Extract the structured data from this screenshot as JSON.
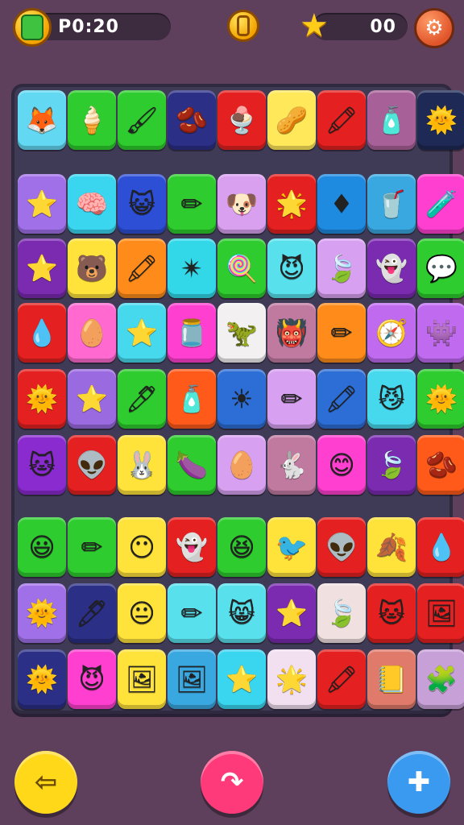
{
  "hud": {
    "moves_label": "P0:20",
    "moves_icon": "leaf-coin-icon",
    "center_icon": "gold-coin-icon",
    "score_value": "00",
    "score_icon": "star-icon",
    "settings_icon": "gear-icon"
  },
  "board": {
    "rows": [
      [
        {
          "color": "#63d8f2",
          "icon": "fox-face-icon",
          "g": "🦊"
        },
        {
          "color": "#2ecc2e",
          "icon": "ice-cream-icon",
          "g": "🍦"
        },
        {
          "color": "#2ecc2e",
          "icon": "brush-icon",
          "g": "🖌"
        },
        {
          "color": "#2b2f86",
          "icon": "jellybean-icon",
          "g": "🫘"
        },
        {
          "color": "#e52020",
          "icon": "ice-cream-cone-icon",
          "g": "🍨"
        },
        {
          "color": "#ffe95a",
          "icon": "bean-face-icon",
          "g": "🥜"
        },
        {
          "color": "#e52020",
          "icon": "crayon-icon",
          "g": "🖍"
        },
        {
          "color": "#a86098",
          "icon": "eraser-icon",
          "g": "🧴"
        },
        {
          "color": "#1e2a55",
          "icon": "sun-cone-icon",
          "g": "🌞"
        }
      ],
      [
        {
          "color": "#a070e8",
          "icon": "star-icon",
          "g": "⭐"
        },
        {
          "color": "#3ad6f0",
          "icon": "brain-icon",
          "g": "🧠"
        },
        {
          "color": "#2d4fd6",
          "icon": "cat-face-icon",
          "g": "😺"
        },
        {
          "color": "#2ecc2e",
          "icon": "pencil-icon",
          "g": "✏"
        },
        {
          "color": "#d9a0f0",
          "icon": "dog-face-icon",
          "g": "🐶"
        },
        {
          "color": "#e52020",
          "icon": "star-icon",
          "g": "🌟"
        },
        {
          "color": "#1e8ae0",
          "icon": "diamond-sign-icon",
          "g": "♦"
        },
        {
          "color": "#3aa8e0",
          "icon": "cup-icon",
          "g": "🥤"
        },
        {
          "color": "#ff3fd0",
          "icon": "glue-stick-icon",
          "g": "🧪"
        }
      ],
      [
        {
          "color": "#7a2bb0",
          "icon": "star-icon",
          "g": "⭐"
        },
        {
          "color": "#ffe23a",
          "icon": "bear-face-icon",
          "g": "🐻"
        },
        {
          "color": "#ff8c1a",
          "icon": "crayon-icon",
          "g": "🖍"
        },
        {
          "color": "#33d8e8",
          "icon": "starburst-icon",
          "g": "✴"
        },
        {
          "color": "#2ecc2e",
          "icon": "lollipop-icon",
          "g": "🍭"
        },
        {
          "color": "#58e0ec",
          "icon": "devil-face-icon",
          "g": "😈"
        },
        {
          "color": "#d8a0f0",
          "icon": "leaf-icon",
          "g": "🍃"
        },
        {
          "color": "#7a2bb0",
          "icon": "ghost-icon",
          "g": "👻"
        },
        {
          "color": "#2ecc2e",
          "icon": "speech-face-icon",
          "g": "💬"
        }
      ],
      [
        {
          "color": "#e52020",
          "icon": "drop-face-icon",
          "g": "💧"
        },
        {
          "color": "#ff69d0",
          "icon": "egg-face-icon",
          "g": "🥚"
        },
        {
          "color": "#46d8ec",
          "icon": "star-icon",
          "g": "⭐"
        },
        {
          "color": "#ff3fd0",
          "icon": "jar-face-icon",
          "g": "🫙"
        },
        {
          "color": "#f2f0f0",
          "icon": "dino-icon",
          "g": "🦖"
        },
        {
          "color": "#c07aa0",
          "icon": "devil-face-icon",
          "g": "👹"
        },
        {
          "color": "#ff8c1a",
          "icon": "pencil-icon",
          "g": "✏"
        },
        {
          "color": "#c06af0",
          "icon": "compass-icon",
          "g": "🧭"
        },
        {
          "color": "#c06af0",
          "icon": "blob-face-icon",
          "g": "👾"
        }
      ],
      [
        {
          "color": "#e52020",
          "icon": "sun-face-icon",
          "g": "🌞"
        },
        {
          "color": "#9a6ae0",
          "icon": "star-icon",
          "g": "⭐"
        },
        {
          "color": "#2ecc2e",
          "icon": "marker-icon",
          "g": "🖊"
        },
        {
          "color": "#ff5a1a",
          "icon": "glue-stick-icon",
          "g": "🧴"
        },
        {
          "color": "#2d6ed6",
          "icon": "sun-face-icon",
          "g": "☀"
        },
        {
          "color": "#d8a0f0",
          "icon": "pencil-icon",
          "g": "✏"
        },
        {
          "color": "#2d6ed6",
          "icon": "crayon-icon",
          "g": "🖍"
        },
        {
          "color": "#46d8ec",
          "icon": "cat-face-icon",
          "g": "😼"
        },
        {
          "color": "#2ecc2e",
          "icon": "sun-face-icon",
          "g": "🌞"
        }
      ],
      [
        {
          "color": "#8a2bd0",
          "icon": "cat-face-icon",
          "g": "🐱"
        },
        {
          "color": "#e52020",
          "icon": "alien-face-icon",
          "g": "👽"
        },
        {
          "color": "#ffe23a",
          "icon": "bunny-face-icon",
          "g": "🐰"
        },
        {
          "color": "#2ecc2e",
          "icon": "jellybean-icon",
          "g": "🍆"
        },
        {
          "color": "#d8a0f0",
          "icon": "egg-face-icon",
          "g": "🥚"
        },
        {
          "color": "#c07aa0",
          "icon": "bunny-face-icon",
          "g": "🐇"
        },
        {
          "color": "#ff3fd0",
          "icon": "smiley-face-icon",
          "g": "😊"
        },
        {
          "color": "#7a2bb0",
          "icon": "leaf-icon",
          "g": "🍃"
        },
        {
          "color": "#ff5a1a",
          "icon": "jellybean-icon",
          "g": "🫘"
        }
      ],
      [
        {
          "color": "#2ecc2e",
          "icon": "blob-face-icon",
          "g": "😃"
        },
        {
          "color": "#2ecc2e",
          "icon": "pencil-icon",
          "g": "✏"
        },
        {
          "color": "#ffe23a",
          "icon": "blob-face-icon",
          "g": "😶"
        },
        {
          "color": "#e52020",
          "icon": "ghost-face-icon",
          "g": "👻"
        },
        {
          "color": "#2ecc2e",
          "icon": "blob-face-icon",
          "g": "😆"
        },
        {
          "color": "#ffe23a",
          "icon": "bird-icon",
          "g": "🐦"
        },
        {
          "color": "#e52020",
          "icon": "alien-face-icon",
          "g": "👽"
        },
        {
          "color": "#ffe23a",
          "icon": "leaf-icon",
          "g": "🍂"
        },
        {
          "color": "#e52020",
          "icon": "drop-icon",
          "g": "💧"
        }
      ],
      [
        {
          "color": "#a070e8",
          "icon": "sun-face-icon",
          "g": "🌞"
        },
        {
          "color": "#2b2f86",
          "icon": "marker-icon",
          "g": "🖊"
        },
        {
          "color": "#ffe23a",
          "icon": "blob-face-icon",
          "g": "😐"
        },
        {
          "color": "#58e0ec",
          "icon": "pencil-icon",
          "g": "✏"
        },
        {
          "color": "#58e0ec",
          "icon": "cat-face-icon",
          "g": "😸"
        },
        {
          "color": "#7a2bb0",
          "icon": "star-icon",
          "g": "⭐"
        },
        {
          "color": "#f0e0e0",
          "icon": "leaf-icon",
          "g": "🍃"
        },
        {
          "color": "#e52020",
          "icon": "cat-face-icon",
          "g": "🐱"
        },
        {
          "color": "#e52020",
          "icon": "frame-icon",
          "g": "🖼"
        }
      ],
      [
        {
          "color": "#2b2f86",
          "icon": "sun-face-icon",
          "g": "🌞"
        },
        {
          "color": "#ff3fd0",
          "icon": "blob-face-icon",
          "g": "😈"
        },
        {
          "color": "#ffe23a",
          "icon": "frame-icon",
          "g": "🖼"
        },
        {
          "color": "#3aa8e0",
          "icon": "frame-icon",
          "g": "🖼"
        },
        {
          "color": "#3ad6f0",
          "icon": "star-icon",
          "g": "⭐"
        },
        {
          "color": "#f2e0f0",
          "icon": "star-icon",
          "g": "🌟"
        },
        {
          "color": "#e52020",
          "icon": "crayon-icon",
          "g": "🖍"
        },
        {
          "color": "#e07a6a",
          "icon": "notepad-icon",
          "g": "📒"
        },
        {
          "color": "#c8a0d8",
          "icon": "puzzle-piece-icon",
          "g": "🧩"
        }
      ]
    ]
  },
  "controls": {
    "left": {
      "icon": "back-arrow-icon",
      "color": "#ffd81a",
      "g": "⇦"
    },
    "center": {
      "icon": "undo-arrow-icon",
      "color": "#ff3a7a",
      "g": "↷"
    },
    "right": {
      "icon": "plus-arrow-icon",
      "color": "#3a9af0",
      "g": "✚"
    }
  }
}
